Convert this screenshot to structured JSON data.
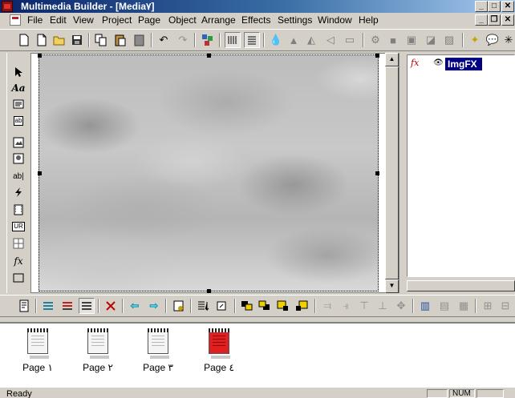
{
  "window": {
    "title": "Multimedia Builder - [Media٧]",
    "controls": [
      "_",
      "□",
      "✕"
    ],
    "mdi_controls": [
      "_",
      "❐",
      "✕"
    ]
  },
  "menu": [
    "File",
    "Edit",
    "View",
    "Project",
    "Page",
    "Object",
    "Arrange",
    "Effects",
    "Settings",
    "Window",
    "Help"
  ],
  "toolbar_icons": [
    "new-icon",
    "new-page-icon",
    "open-icon",
    "save-icon",
    "copy-icon",
    "paste-icon",
    "paste-special-icon",
    "undo-icon",
    "redo-icon",
    "group-icon",
    "grid-icon",
    "layers-icon",
    "drop-icon",
    "align-icon",
    "flip-icon",
    "arrow-left-icon",
    "export-icon",
    "gear-icon",
    "square-icon",
    "frame-icon",
    "fill-icon",
    "image-icon",
    "wand-icon",
    "bubble-icon",
    "star-icon"
  ],
  "left_tools": [
    "pointer-icon",
    "text-icon",
    "paragraph-icon",
    "button-icon",
    "image-icon",
    "bitmap-button-icon",
    "input-text-icon",
    "gif-icon",
    "video-icon",
    "url-icon",
    "grid-icon",
    "fx-icon",
    "rectangle-icon"
  ],
  "left_tool_glyphs": {
    "text": "Aa",
    "button": "ab",
    "input": "ab|",
    "url": "UR",
    "fx": "fx"
  },
  "objects_panel": {
    "items": [
      {
        "icon": "fx",
        "label": "ImgFX",
        "visible": true,
        "selected": true
      }
    ]
  },
  "pages": [
    {
      "label": "Page ١",
      "active": false
    },
    {
      "label": "Page ٢",
      "active": false
    },
    {
      "label": "Page ٣",
      "active": false
    },
    {
      "label": "Page ٤",
      "active": true
    }
  ],
  "status": {
    "text": "Ready",
    "num": "NUM"
  },
  "colors": {
    "title_start": "#0a246a",
    "title_end": "#a6caf0",
    "selection": "#000080",
    "active_page": "#e02020"
  }
}
